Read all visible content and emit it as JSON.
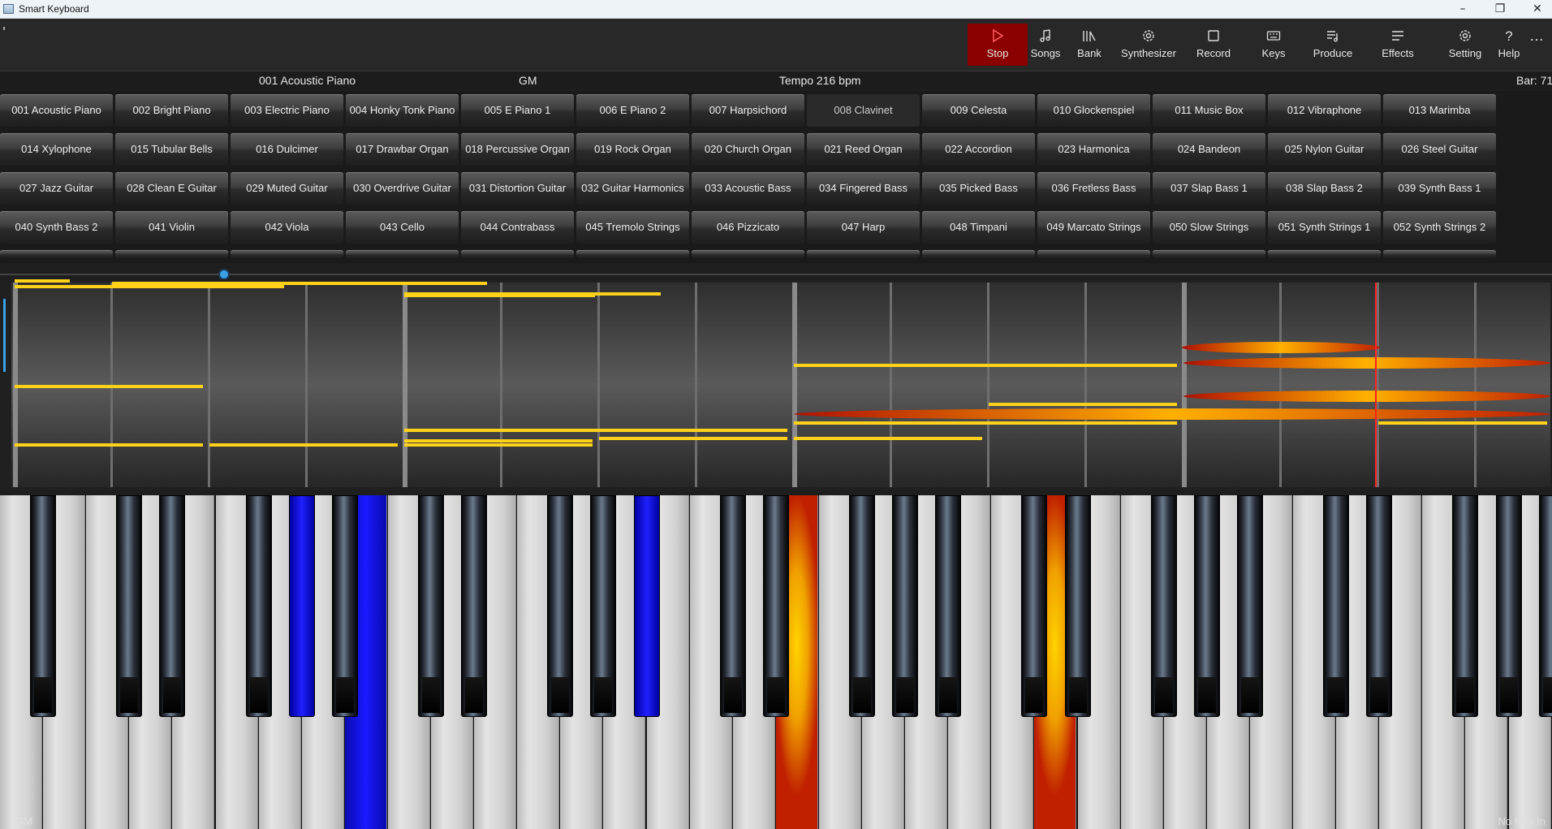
{
  "window": {
    "title": "Smart Keyboard"
  },
  "toolbar": {
    "buttons": [
      {
        "id": "stop",
        "label": "Stop",
        "icon": "play-icon"
      },
      {
        "id": "songs",
        "label": "Songs",
        "icon": "music-note-icon"
      },
      {
        "id": "bank",
        "label": "Bank",
        "icon": "library-icon"
      },
      {
        "id": "synthesizer",
        "label": "Synthesizer",
        "icon": "gear-icon"
      },
      {
        "id": "record",
        "label": "Record",
        "icon": "square-icon"
      },
      {
        "id": "keys",
        "label": "Keys",
        "icon": "keyboard-icon"
      },
      {
        "id": "produce",
        "label": "Produce",
        "icon": "music-list-icon"
      },
      {
        "id": "effects",
        "label": "Effects",
        "icon": "lines-icon"
      },
      {
        "id": "setting",
        "label": "Setting",
        "icon": "gear-icon"
      },
      {
        "id": "help",
        "label": "Help",
        "icon": "question-icon"
      }
    ],
    "more": "…"
  },
  "info": {
    "instrument": "001 Acoustic Piano",
    "bank": "GM",
    "tempo": "Tempo 216 bpm",
    "bar": "Bar: 71"
  },
  "instruments": [
    "001 Acoustic Piano",
    "002 Bright Piano",
    "003 Electric Piano",
    "004 Honky Tonk Piano",
    "005 E Piano 1",
    "006 E Piano 2",
    "007 Harpsichord",
    "008 Clavinet",
    "009 Celesta",
    "010 Glockenspiel",
    "011 Music Box",
    "012 Vibraphone",
    "013 Marimba",
    "014 Xylophone",
    "015 Tubular Bells",
    "016 Dulcimer",
    "017 Drawbar Organ",
    "018 Percussive Organ",
    "019 Rock Organ",
    "020 Church Organ",
    "021 Reed Organ",
    "022 Accordion",
    "023 Harmonica",
    "024 Bandeon",
    "025 Nylon Guitar",
    "026 Steel Guitar",
    "027 Jazz Guitar",
    "028 Clean E Guitar",
    "029 Muted Guitar",
    "030 Overdrive Guitar",
    "031 Distortion Guitar",
    "032 Guitar Harmonics",
    "033 Acoustic Bass",
    "034 Fingered Bass",
    "035 Picked Bass",
    "036 Fretless Bass",
    "037 Slap Bass 1",
    "038 Slap Bass 2",
    "039 Synth Bass 1",
    "040 Synth Bass 2",
    "041 Violin",
    "042 Viola",
    "043 Cello",
    "044 Contrabass",
    "045 Tremolo Strings",
    "046 Pizzicato",
    "047 Harp",
    "048 Timpani",
    "049 Marcato Strings",
    "050 Slow Strings",
    "051 Synth Strings 1",
    "052 Synth Strings 2"
  ],
  "selected_instrument": "008 Clavinet",
  "colors": {
    "note": "#ffd21a",
    "active_note": "#ff8c00",
    "playhead": "#ff2020",
    "stop_bg": "#8b0000",
    "knob": "#3aa0e8",
    "left_hand": "#1a1aff",
    "right_hand": "#ffb000"
  },
  "status": {
    "bank": "GM",
    "midi": "No Midi In"
  }
}
